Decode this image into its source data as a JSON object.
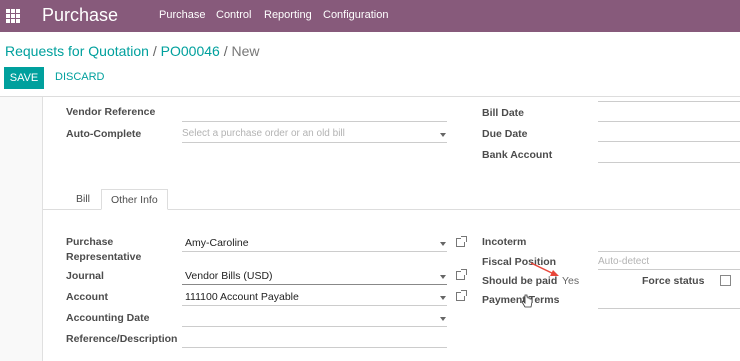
{
  "navbar": {
    "app_name": "Purchase",
    "menu": [
      "Purchase",
      "Control",
      "Reporting",
      "Configuration"
    ]
  },
  "breadcrumb": {
    "item1": "Requests for Quotation",
    "sep": "/",
    "item2": "PO00046",
    "item3": "New"
  },
  "buttons": {
    "save": "SAVE",
    "discard": "DISCARD"
  },
  "form_top": {
    "vendor_reference_label": "Vendor Reference",
    "auto_complete_label": "Auto-Complete",
    "auto_complete_placeholder": "Select a purchase order or an old bill",
    "bill_date_label": "Bill Date",
    "due_date_label": "Due Date",
    "bank_account_label": "Bank Account"
  },
  "tabs": [
    "Bill",
    "Other Info"
  ],
  "other_info": {
    "purchase_rep_label_1": "Purchase",
    "purchase_rep_label_2": "Representative",
    "purchase_rep_value": "Amy-Caroline",
    "journal_label": "Journal",
    "journal_value": "Vendor Bills (USD)",
    "account_label": "Account",
    "account_value": "111100 Account Payable",
    "accounting_date_label": "Accounting Date",
    "reference_label": "Reference/Description",
    "incoterm_label": "Incoterm",
    "fiscal_position_label": "Fiscal Position",
    "fiscal_position_placeholder": "Auto-detect",
    "should_be_paid_label": "Should be paid",
    "should_be_paid_value": "Yes",
    "force_status_label": "Force status",
    "payment_terms_label": "Payment Terms"
  },
  "colors": {
    "navbar": "#875a7b",
    "accent": "#00a09d",
    "annotation_arrow": "#e8463a"
  }
}
